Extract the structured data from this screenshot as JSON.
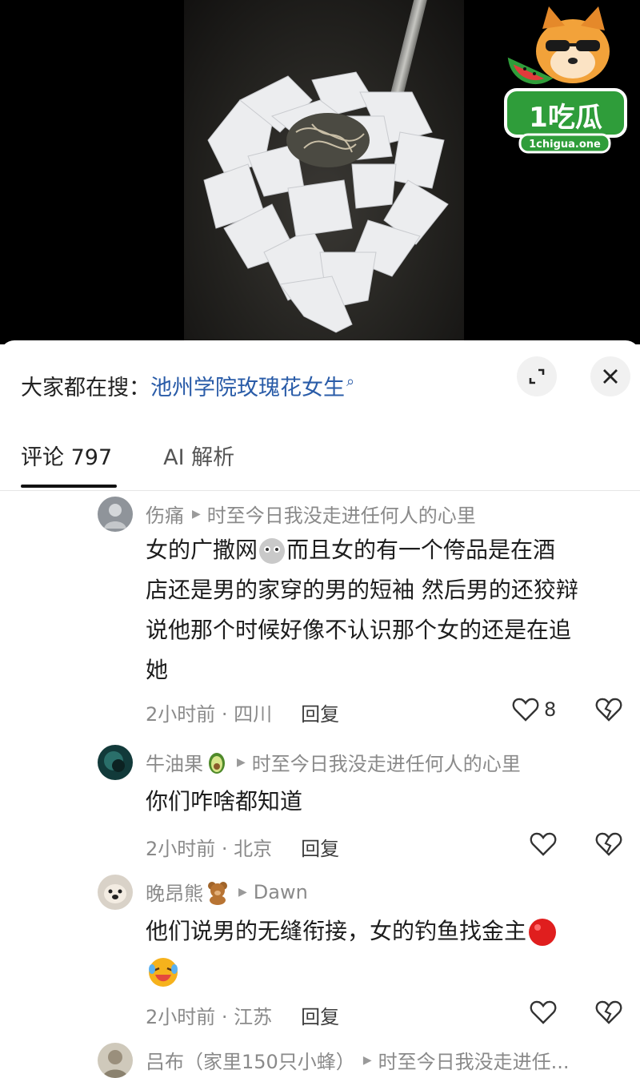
{
  "watermark": {
    "top": "1吃瓜",
    "site": "1chigua.one"
  },
  "search": {
    "prefix": "大家都在搜：",
    "term": "池州学院玫瑰花女生",
    "glyph": "⌕"
  },
  "tabs": [
    {
      "label": "评论 797"
    },
    {
      "label": "AI 解析"
    }
  ],
  "comments": [
    {
      "username": "伤痛",
      "reply_to": "时至今日我没走进任何人的心里",
      "text_lines": [
        "女的广撒网",
        "而且女的有一个侉品是在酒",
        "店还是男的家穿的男的短袖 然后男的还狡辩",
        "说他那个时候好像不认识那个女的还是在追",
        "她"
      ],
      "time_location": "2小时前 · 四川",
      "reply_label": "回复",
      "likes": "8"
    },
    {
      "username": "牛油果",
      "reply_to": "时至今日我没走进任何人的心里",
      "text": "你们咋啥都知道",
      "time_location": "2小时前 · 北京",
      "reply_label": "回复"
    },
    {
      "username": "晚昂熊",
      "reply_to": "Dawn",
      "text": "他们说男的无缝衔接，女的钓鱼找金主",
      "time_location": "2小时前 · 江苏",
      "reply_label": "回复"
    },
    {
      "username": "吕布（家里150只小蜂）",
      "reply_to": "时至今日我没走进任..."
    }
  ],
  "colors": {
    "link": "#2a5ca8",
    "meta": "#8a8a8a",
    "text": "#1d1d1d"
  }
}
